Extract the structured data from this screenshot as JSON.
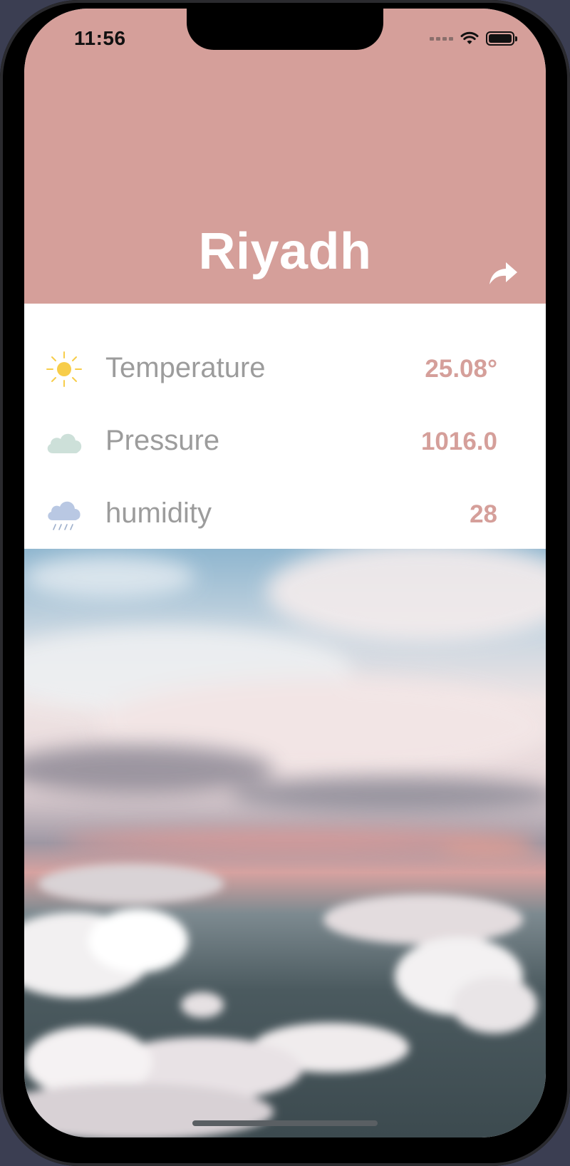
{
  "status_bar": {
    "time": "11:56"
  },
  "header": {
    "city": "Riyadh",
    "background_color": "#d59f9a",
    "share_icon": "share-arrow-icon"
  },
  "rows": [
    {
      "icon": "sun-icon",
      "label": "Temperature",
      "value": "25.08°"
    },
    {
      "icon": "cloud-icon",
      "label": "Pressure",
      "value": "1016.0"
    },
    {
      "icon": "rain-cloud-icon",
      "label": "humidity",
      "value": "28"
    }
  ],
  "accent_color": "#d59f9a",
  "label_color": "#9c9c9c"
}
